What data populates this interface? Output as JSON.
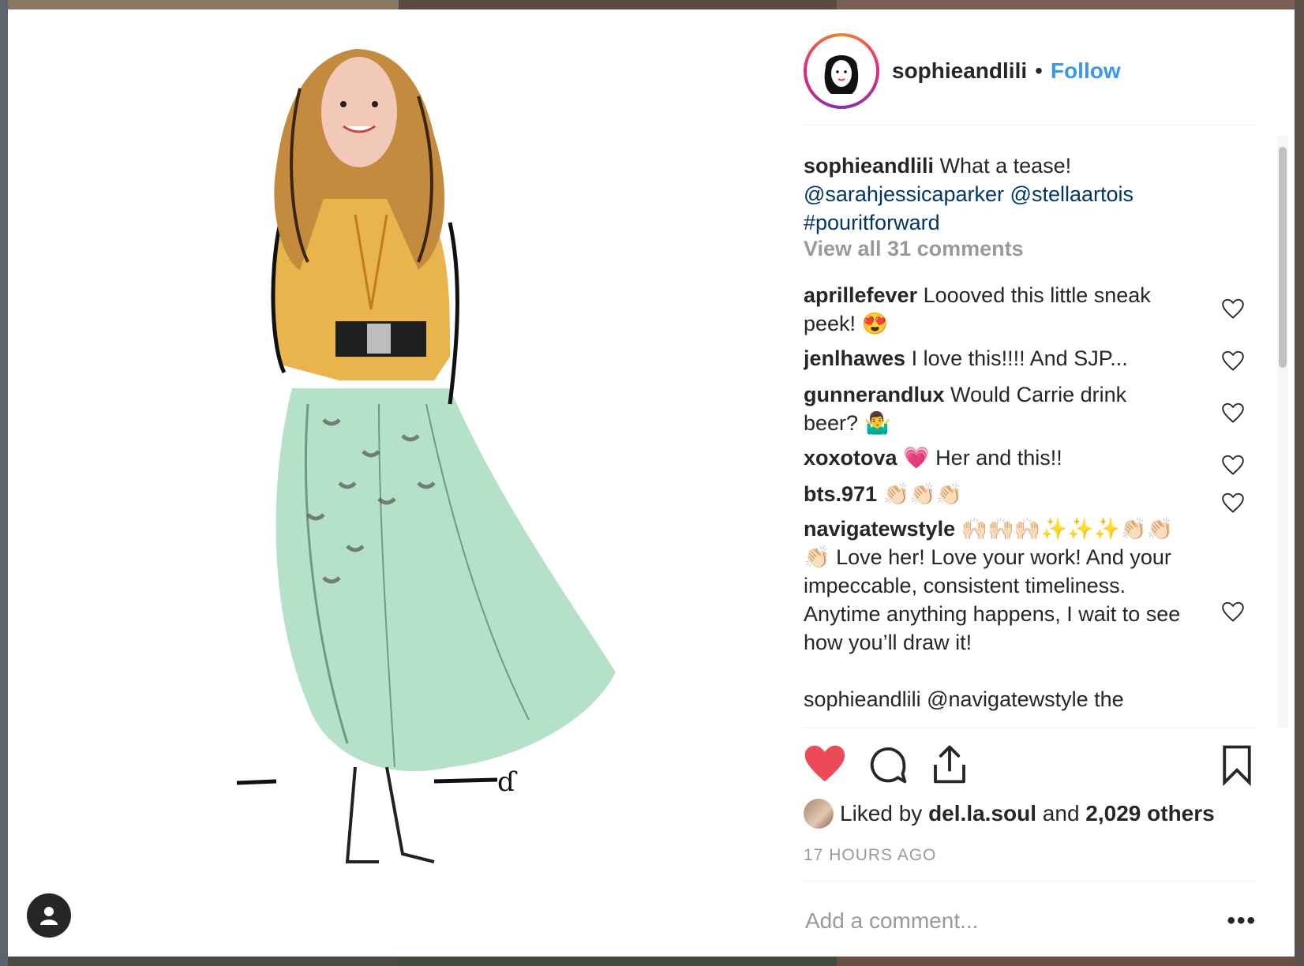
{
  "post": {
    "username": "sophieandlili",
    "follow_label": "Follow",
    "caption": {
      "username": "sophieandlili",
      "text": "What a tease!",
      "mention1": "@sarahjessicaparker",
      "mention2": "@stellaartois",
      "hashtag": "#pouritforward"
    },
    "view_all": "View all 31 comments",
    "comments": [
      {
        "user": "aprillefever",
        "text": "Loooved this little sneak peek! 😍"
      },
      {
        "user": "jenlhawes",
        "text": "I love this!!!! And SJP..."
      },
      {
        "user": "gunnerandlux",
        "text": "Would Carrie drink beer? 🤷‍♂️"
      },
      {
        "user": "xoxotova",
        "text": "💗  Her and this!!"
      },
      {
        "user": "bts.971",
        "text": "👏🏻👏🏻👏🏻"
      },
      {
        "user": "navigatewstyle",
        "text": "🙌🏻🙌🏻🙌🏻✨✨✨👏🏻👏🏻👏🏻  Love her! Love your work! And your impeccable, consistent timeliness. Anytime anything happens, I wait to see how you’ll draw it!"
      }
    ],
    "partial_comment": "sophieandlili @navigatewstyle the",
    "liked_by_prefix": "Liked by",
    "liked_by_user": "del.la.soul",
    "liked_by_and": "and",
    "liked_by_others": "2,029 others",
    "timestamp": "17 HOURS AGO",
    "comment_placeholder": "Add a comment...",
    "more_label": "•••"
  },
  "colors": {
    "like_red": "#ed4956",
    "link_blue": "#3897f0",
    "mention_blue": "#003569",
    "muted_gray": "#999999"
  },
  "icons": [
    "heart-filled-icon",
    "comment-icon",
    "share-icon",
    "bookmark-icon",
    "heart-outline-icon",
    "user-icon"
  ]
}
